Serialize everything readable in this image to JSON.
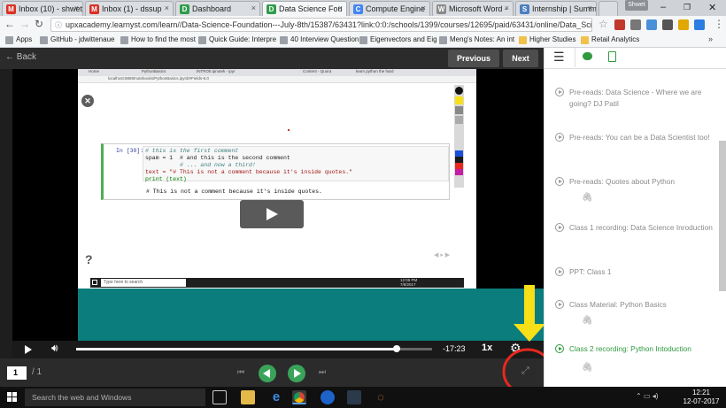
{
  "browser": {
    "tabs": [
      {
        "label": "Inbox (10) - shwet",
        "color": "#d93025",
        "glyph": "M",
        "active": false
      },
      {
        "label": "Inbox (1) - dssup",
        "color": "#d93025",
        "glyph": "M",
        "active": false
      },
      {
        "label": "Dashboard",
        "color": "#2e9c4a",
        "glyph": "D",
        "active": false
      },
      {
        "label": "Data Science Fou",
        "color": "#2e9c4a",
        "glyph": "D",
        "active": true
      },
      {
        "label": "Compute Engine",
        "color": "#4285f4",
        "glyph": "C",
        "active": false
      },
      {
        "label": "Microsoft Word -",
        "color": "#8a8a8a",
        "glyph": "W",
        "active": false
      },
      {
        "label": "Internship | Summ",
        "color": "#4a7fc1",
        "glyph": "S",
        "active": false
      }
    ],
    "user_badge": "Shwet",
    "url": "upxacademy.learnyst.com/learn//Data-Science-Foundation---July-8th/15387/63431?link:0:0:/schools/1399/courses/12695/paid/63431/online/Data_Sci",
    "bookmarks": [
      {
        "label": "Apps",
        "folder": false
      },
      {
        "label": "GitHub - jdwittenaue",
        "folder": false
      },
      {
        "label": "How to find the most",
        "folder": false
      },
      {
        "label": "Quick Guide: Interpre",
        "folder": false
      },
      {
        "label": "40 Interview Question",
        "folder": false
      },
      {
        "label": "Eigenvectors and Eig",
        "folder": false
      },
      {
        "label": "Meng's Notes: An int",
        "folder": false
      },
      {
        "label": "Higher Studies",
        "folder": true
      },
      {
        "label": "Retail Analytics",
        "folder": true
      }
    ]
  },
  "course": {
    "back_label": "Back",
    "previous_label": "Previous",
    "next_label": "Next"
  },
  "video": {
    "inner_tabs": [
      "Home",
      "PythonBasics",
      "INTRO5.ipnotek - ipyr",
      "",
      "Content - Quora",
      "learn python the hard"
    ],
    "inner_url": "localhost:8889/notebooks/PythonBasics.ipynb#Fields-6.0",
    "cell_prompt": "In [30]:",
    "code_lines": [
      "# this is the first comment",
      "spam = 1  # and this is the second comment",
      "          # ... and now a third!",
      "text = \"# This is not a comment because it's inside quotes.\"",
      "print (text)"
    ],
    "output_line": "# This is not a comment because it's inside quotes.",
    "help_mark": "?",
    "inner_search": "Type here to search",
    "inner_time": "12:05 PM",
    "inner_date": "7/8/2017",
    "time_remaining": "-17:23",
    "speed": "1x",
    "progress": 0.9
  },
  "pager": {
    "current_page": "1",
    "total_pages": "/ 1"
  },
  "sidebar": {
    "lessons": [
      {
        "title": "Pre-reads: Data Science - Where we are going? DJ Patil",
        "active": false,
        "clip": false
      },
      {
        "title": "Pre-reads: You can be a Data Scientist too!",
        "active": false,
        "clip": false
      },
      {
        "title": "Pre-reads: Quotes about Python",
        "active": false,
        "clip": true
      },
      {
        "title": "Class 1 recording: Data Science Inroduction",
        "active": false,
        "clip": false
      },
      {
        "title": "PPT: Class 1",
        "active": false,
        "clip": false
      },
      {
        "title": "Class Material: Python Basics",
        "active": false,
        "clip": true
      },
      {
        "title": "Class 2 recording: Python Intoduction",
        "active": true,
        "clip": true
      }
    ]
  },
  "taskbar": {
    "search_placeholder": "Search the web and Windows",
    "time": "12:21",
    "date": "12-07-2017"
  },
  "colors": {
    "accent_green": "#2f9a3e",
    "annotation_yellow": "#f7e017",
    "annotation_red": "#e8281e",
    "teal": "#0b7d7d"
  }
}
